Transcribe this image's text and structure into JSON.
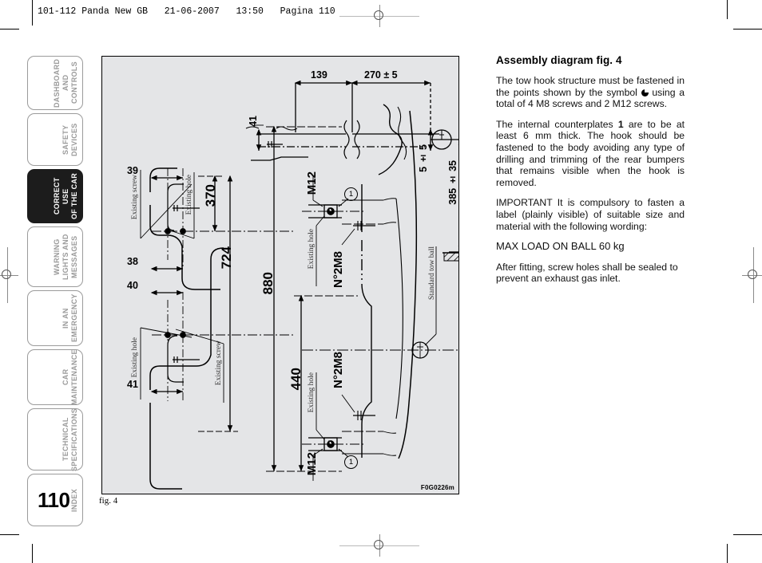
{
  "document": {
    "running_head": "101-112 Panda New GB   21-06-2007   13:50   Pagina 110",
    "page_number": "110"
  },
  "sidebar": {
    "tabs": [
      {
        "label": "DASHBOARD\nAND CONTROLS",
        "active": false
      },
      {
        "label": "SAFETY\nDEVICES",
        "active": false
      },
      {
        "label": "CORRECT USE\nOF THE CAR",
        "active": true
      },
      {
        "label": "WARNING\nLIGHTS AND\nMESSAGES",
        "active": false
      },
      {
        "label": "IN AN\nEMERGENCY",
        "active": false
      },
      {
        "label": "CAR\nMAINTENANCE",
        "active": false
      },
      {
        "label": "TECHNICAL\nSPECIFICATIONS",
        "active": false
      },
      {
        "label": "INDEX",
        "active": false
      }
    ]
  },
  "figure": {
    "caption": "fig. 4",
    "code": "F0G0226m",
    "dimensions": {
      "d139": "139",
      "d270": "270 ± 5",
      "d41_top": "41",
      "d5pm5": "5 ± 5",
      "d385": "385 ± 35",
      "d39": "39",
      "d38": "38",
      "d40": "40",
      "d41_bottom": "41",
      "d370": "370",
      "d724": "724",
      "d880": "880",
      "d440": "440"
    },
    "labels": {
      "m12_top": "M12",
      "m12_bottom": "M12",
      "n2m8_top": "N°2M8",
      "n2m8_bottom": "N°2M8",
      "existing_screw_top": "Existing screw",
      "existing_hole_top": "Existing hole",
      "existing_hole_left_lower": "Existing hole",
      "existing_screw_lower": "Existing screw",
      "existing_hole_right_top": "Existing hole",
      "existing_hole_right_bottom": "Existing hole",
      "standard_tow_ball": "Standard tow ball",
      "callout_1_top": "1",
      "callout_1_bottom": "1"
    }
  },
  "content": {
    "heading": "Assembly diagram fig. 4",
    "p1_a": "The tow hook structure must be fastened in the points shown by the symbol ",
    "p1_b": " using a total of 4 M8 screws and 2 M12 screws.",
    "p2_a": "The internal counterplates ",
    "p2_bold": "1",
    "p2_b": " are to be at least 6 mm thick. The hook should be fastened to the body avoiding any type of drilling and trimming of the rear bumpers that remains visible when the hook is removed.",
    "p3_bold": "IMPORTANT",
    "p3": " It is compulsory to fasten a label (plainly visible) of suitable size and material with the following wording:",
    "p4": "MAX LOAD ON BALL 60 kg",
    "p5": "After fitting, screw holes shall be sealed to prevent an exhaust gas inlet."
  }
}
